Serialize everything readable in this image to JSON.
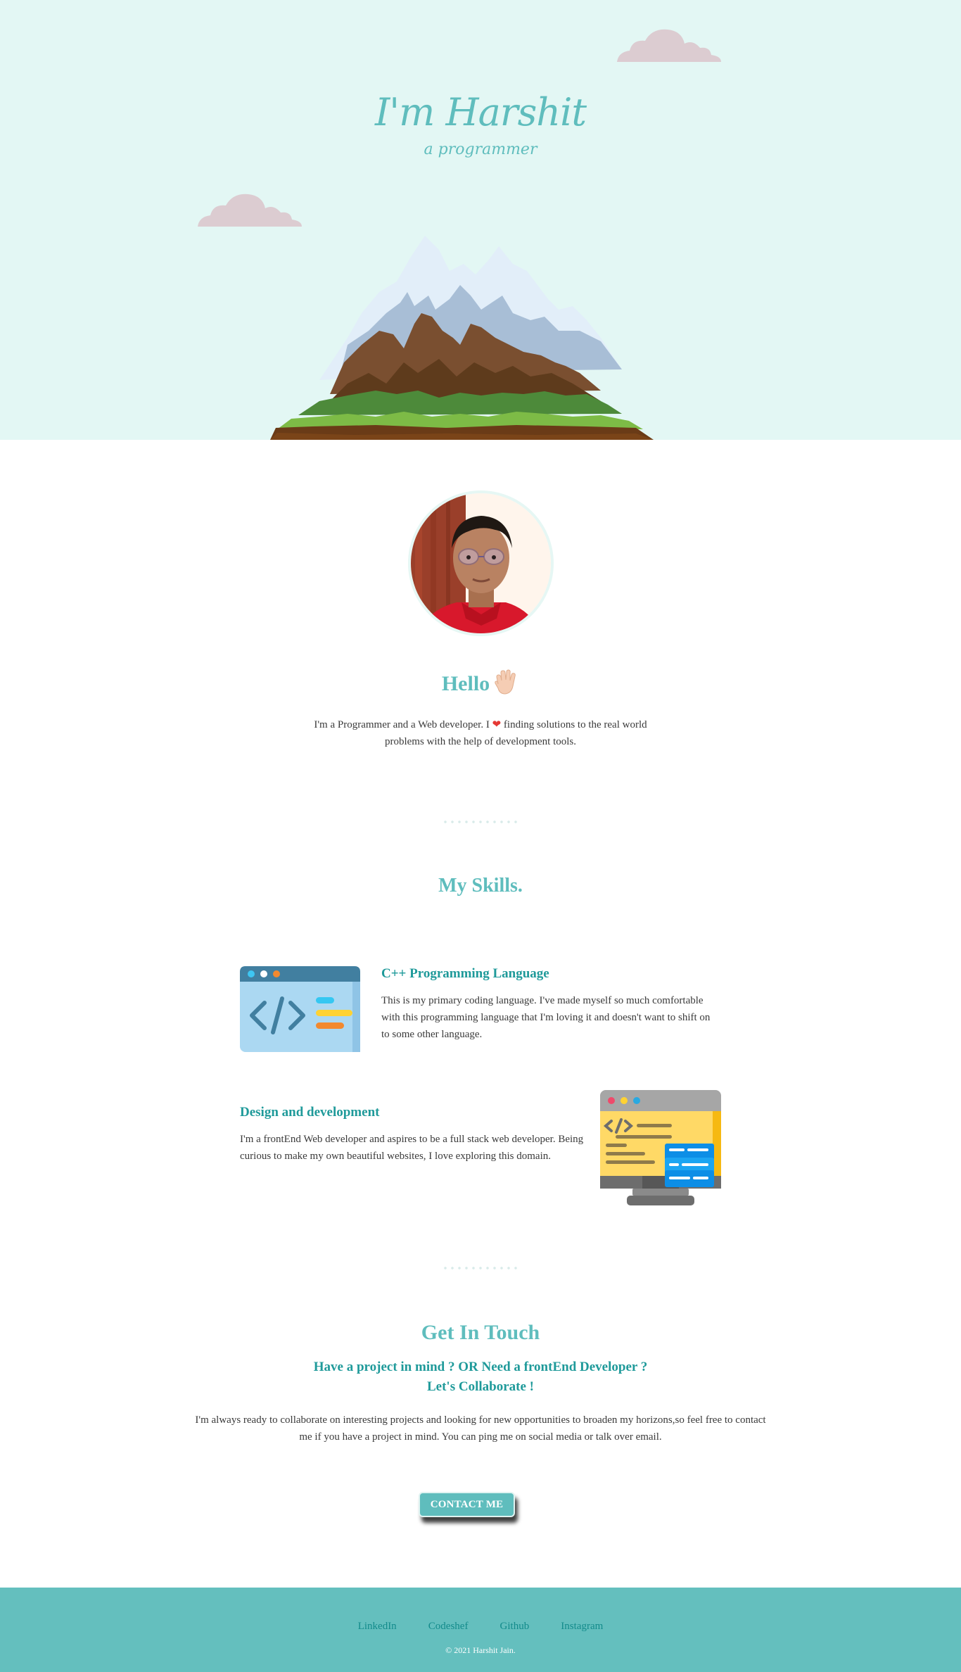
{
  "hero": {
    "title": "I'm Harshit",
    "subtitle": "a programmer"
  },
  "about": {
    "greeting": "Hello",
    "intro_before_heart": "I'm a Programmer and a Web developer. I",
    "intro_after_heart": " finding solutions to the real world problems with the help of development tools."
  },
  "skills": {
    "title": "My Skills.",
    "items": [
      {
        "title": "C++ Programming Language",
        "description": "This is my primary coding language. I've made myself so much comfortable with this programming language that I'm loving it and doesn't want to shift on to some other language.",
        "icon": "code-window-icon"
      },
      {
        "title": "Design and development",
        "description": "I'm a frontEnd Web developer and aspires to be a full stack web developer. Being curious to make my own beautiful websites, I love exploring this domain.",
        "icon": "monitor-code-icon"
      }
    ]
  },
  "contact": {
    "title": "Get In Touch",
    "subtitle_line1": "Have a project in mind ? OR Need a frontEnd Developer ?",
    "subtitle_line2": "Let's Collaborate !",
    "description": "I'm always ready to collaborate on interesting projects and looking for new opportunities to broaden my horizons,so feel free to contact me if you have a project in mind. You can ping me on social media or talk over email.",
    "button_label": "CONTACT ME"
  },
  "footer": {
    "links": [
      "LinkedIn",
      "Codeshef",
      "Github",
      "Instagram"
    ],
    "copyright": "© 2021 Harshit Jain."
  },
  "colors": {
    "accent": "#5fbdbd",
    "accent_dark": "#1f9a9a",
    "hero_bg": "#e3f7f4",
    "footer_bg": "#64bfbe"
  }
}
